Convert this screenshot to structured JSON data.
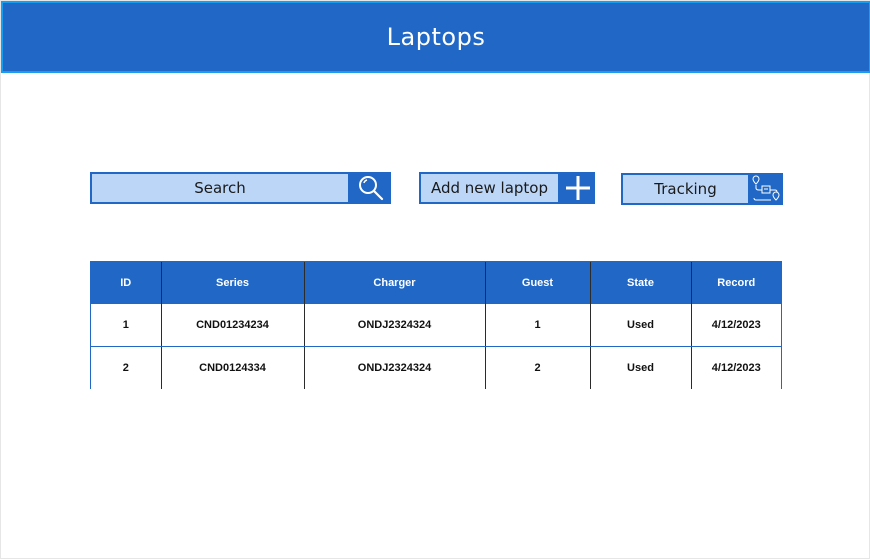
{
  "header": {
    "title": "Laptops"
  },
  "actions": {
    "search_label": "Search",
    "add_label": "Add new laptop",
    "tracking_label": "Tracking"
  },
  "colors": {
    "accent": "#2168c6",
    "button_fill": "#bcd6f7",
    "header_border": "#1a9cf0"
  },
  "icons": {
    "search": "search-icon",
    "add": "plus-icon",
    "tracking": "route-tracking-icon"
  },
  "table": {
    "columns": [
      "ID",
      "Series",
      "Charger",
      "Guest",
      "State",
      "Record"
    ],
    "rows": [
      [
        "1",
        "CND01234234",
        "ONDJ2324324",
        "1",
        "Used",
        "4/12/2023"
      ],
      [
        "2",
        "CND0124334",
        "ONDJ2324324",
        "2",
        "Used",
        "4/12/2023"
      ]
    ]
  }
}
